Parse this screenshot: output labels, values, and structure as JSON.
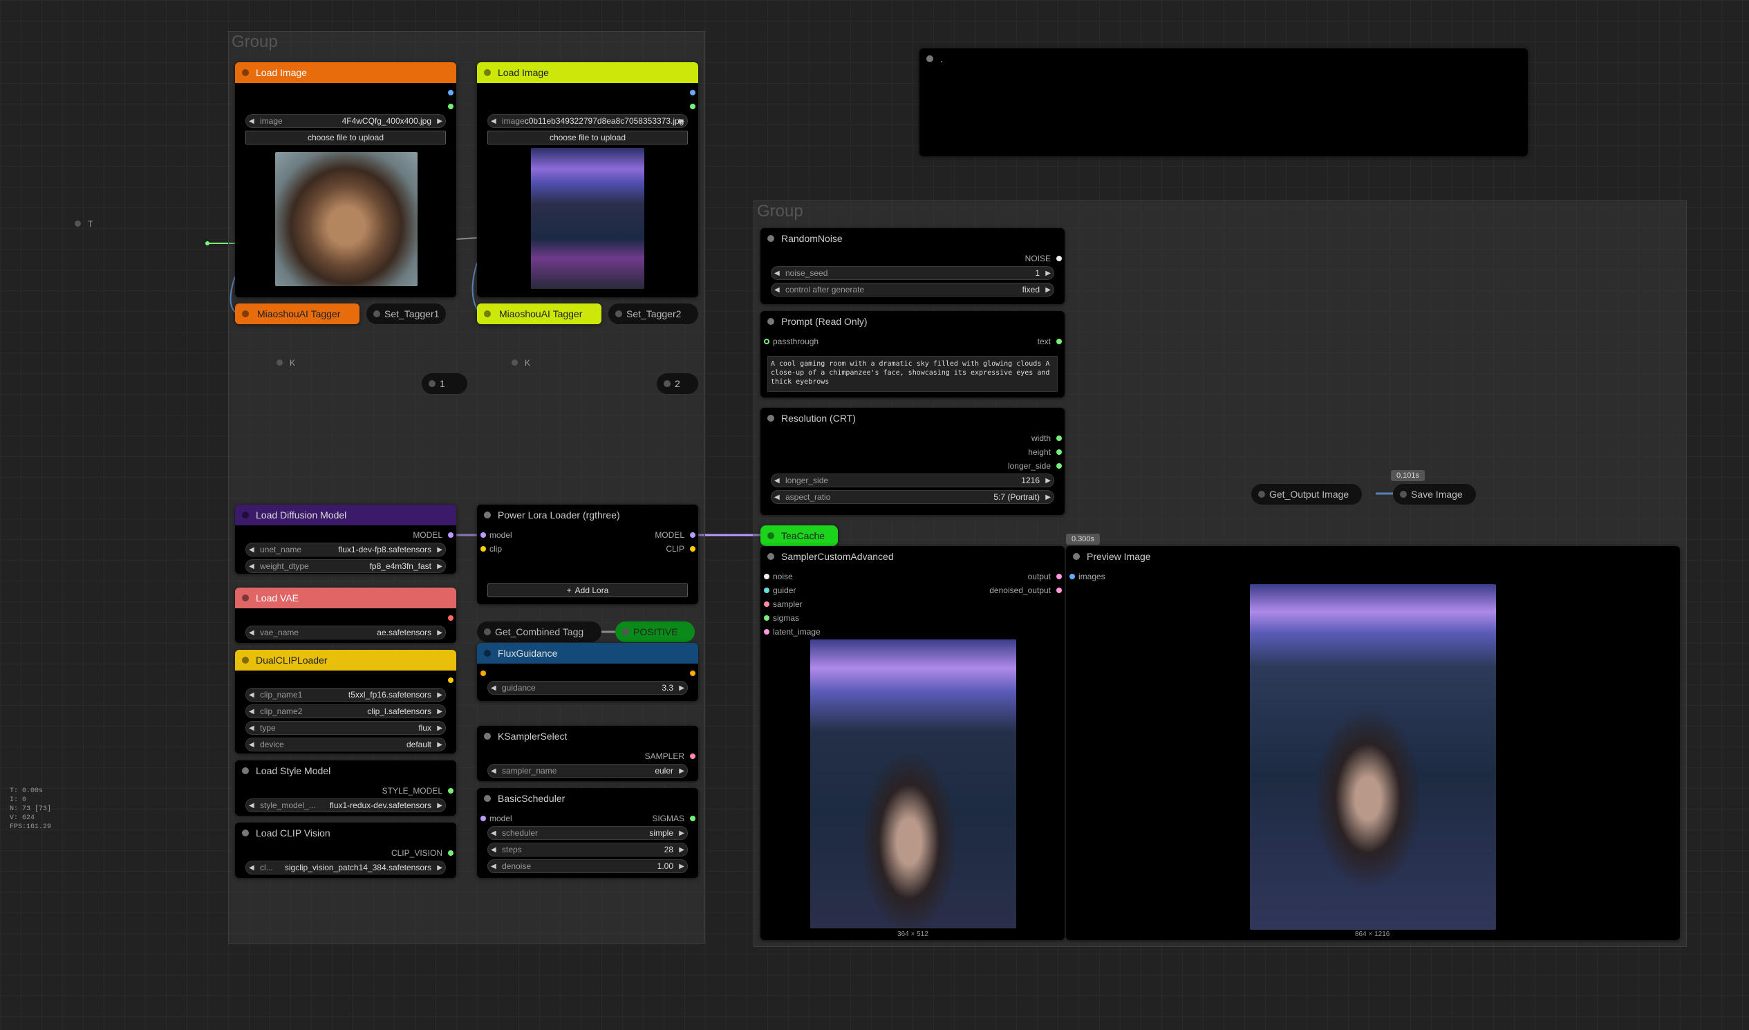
{
  "groups": [
    {
      "title": "Group"
    },
    {
      "title": "Group"
    }
  ],
  "note_node": {
    "title": "."
  },
  "t_node": {
    "title": "T"
  },
  "k1": {
    "title": "K"
  },
  "k2": {
    "title": "K"
  },
  "load_image_1": {
    "title": "Load Image",
    "image_label": "image",
    "image_value": "4F4wCQfg_400x400.jpg",
    "upload": "choose file to upload"
  },
  "load_image_2": {
    "title": "Load Image",
    "image_label": "image",
    "image_value": "c0b11eb349322797d8ea8c7058353373.jpg",
    "upload": "choose file to upload"
  },
  "tagger1": {
    "title": "MiaoshouAI Tagger"
  },
  "tagger2": {
    "title": "MiaoshouAI Tagger"
  },
  "set1": {
    "title": "Set_Tagger1"
  },
  "set2": {
    "title": "Set_Tagger2"
  },
  "num1": {
    "title": "1"
  },
  "num2": {
    "title": "2"
  },
  "diffusion": {
    "title": "Load Diffusion Model",
    "out": "MODEL",
    "w1n": "unet_name",
    "w1v": "flux1-dev-fp8.safetensors",
    "w2n": "weight_dtype",
    "w2v": "fp8_e4m3fn_fast"
  },
  "vae": {
    "title": "Load VAE",
    "w1n": "vae_name",
    "w1v": "ae.safetensors"
  },
  "dualclip": {
    "title": "DualCLIPLoader",
    "w1n": "clip_name1",
    "w1v": "t5xxl_fp16.safetensors",
    "w2n": "clip_name2",
    "w2v": "clip_l.safetensors",
    "w3n": "type",
    "w3v": "flux",
    "w4n": "device",
    "w4v": "default"
  },
  "stylemodel": {
    "title": "Load Style Model",
    "out": "STYLE_MODEL",
    "w1n": "style_model_...",
    "w1v": "flux1-redux-dev.safetensors"
  },
  "clipvision": {
    "title": "Load CLIP Vision",
    "out": "CLIP_VISION",
    "w1n": "cl...",
    "w1v": "sigclip_vision_patch14_384.safetensors"
  },
  "powerlora": {
    "title": "Power Lora Loader (rgthree)",
    "in1": "model",
    "in2": "clip",
    "out1": "MODEL",
    "out2": "CLIP",
    "add": "Add Lora"
  },
  "getcombined": {
    "title": "Get_Combined Tagg"
  },
  "positive": {
    "title": "POSITIVE"
  },
  "fluxguidance": {
    "title": "FluxGuidance",
    "w1n": "guidance",
    "w1v": "3.3"
  },
  "ksamplerselect": {
    "title": "KSamplerSelect",
    "out": "SAMPLER",
    "w1n": "sampler_name",
    "w1v": "euler"
  },
  "basicscheduler": {
    "title": "BasicScheduler",
    "in1": "model",
    "out": "SIGMAS",
    "w1n": "scheduler",
    "w1v": "simple",
    "w2n": "steps",
    "w2v": "28",
    "w3n": "denoise",
    "w3v": "1.00"
  },
  "randomnoise": {
    "title": "RandomNoise",
    "out": "NOISE",
    "w1n": "noise_seed",
    "w1v": "1",
    "w2n": "control after generate",
    "w2v": "fixed"
  },
  "prompt": {
    "title": "Prompt (Read Only)",
    "in1": "passthrough",
    "out": "text",
    "text": "A cool gaming room with a dramatic sky filled with glowing clouds A close-up of a chimpanzee's face, showcasing its expressive eyes and thick eyebrows"
  },
  "resolution": {
    "title": "Resolution (CRT)",
    "out1": "width",
    "out2": "height",
    "out3": "longer_side",
    "w1n": "longer_side",
    "w1v": "1216",
    "w2n": "aspect_ratio",
    "w2v": "5:7 (Portrait)"
  },
  "teacache": {
    "title": "TeaCache"
  },
  "sampler": {
    "title": "SamplerCustomAdvanced",
    "in1": "noise",
    "in2": "guider",
    "in3": "sampler",
    "in4": "sigmas",
    "in5": "latent_image",
    "out1": "output",
    "out2": "denoised_output",
    "caption": "364 × 512",
    "timer": "0.300s"
  },
  "preview": {
    "title": "Preview Image",
    "in1": "images",
    "caption": "864 × 1216"
  },
  "getoutput": {
    "title": "Get_Output Image"
  },
  "saveimage": {
    "title": "Save Image",
    "timer": "0.101s"
  },
  "stats": {
    "t": "T: 0.00s",
    "i": "I: 0",
    "n": "N: 73 [73]",
    "v": "V: 624",
    "fps": "FPS:161.29"
  }
}
